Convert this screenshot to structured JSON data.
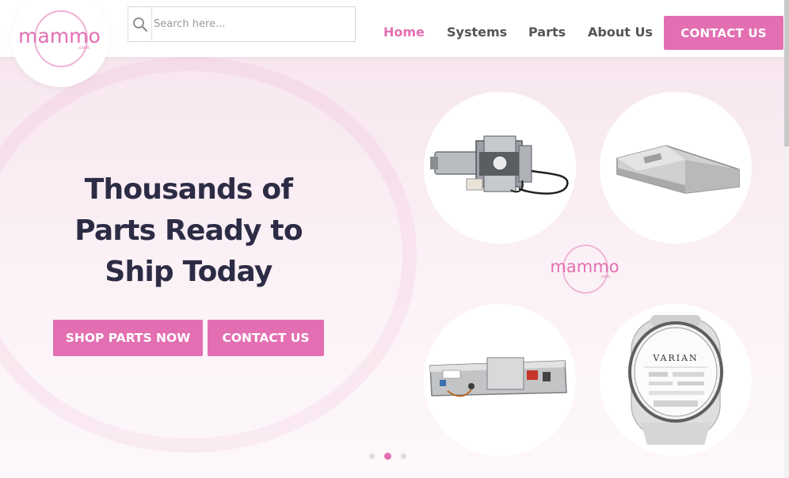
{
  "brand": {
    "logo_text": "mammo",
    "logo_suffix": ".com",
    "accent_color": "#e36fb2",
    "title_color": "#2c2c45"
  },
  "search": {
    "placeholder": "Search here...",
    "icon": "search-icon"
  },
  "nav": {
    "items": [
      {
        "label": "Home",
        "active": true
      },
      {
        "label": "Systems",
        "active": false
      },
      {
        "label": "Parts",
        "active": false
      },
      {
        "label": "About Us",
        "active": false
      }
    ],
    "cta_label": "CONTACT US"
  },
  "hero": {
    "title_lines": [
      "Thousands of",
      "Parts Ready to",
      "Ship Today"
    ],
    "primary_button": "SHOP PARTS NOW",
    "secondary_button": "CONTACT US",
    "products": [
      {
        "name": "motor-assembly"
      },
      {
        "name": "compression-paddle"
      },
      {
        "name": "circuit-board-assembly"
      },
      {
        "name": "varian-xray-tube"
      }
    ],
    "product_label_text": "VARIAN"
  },
  "carousel": {
    "slide_count": 3,
    "active_index": 1
  }
}
